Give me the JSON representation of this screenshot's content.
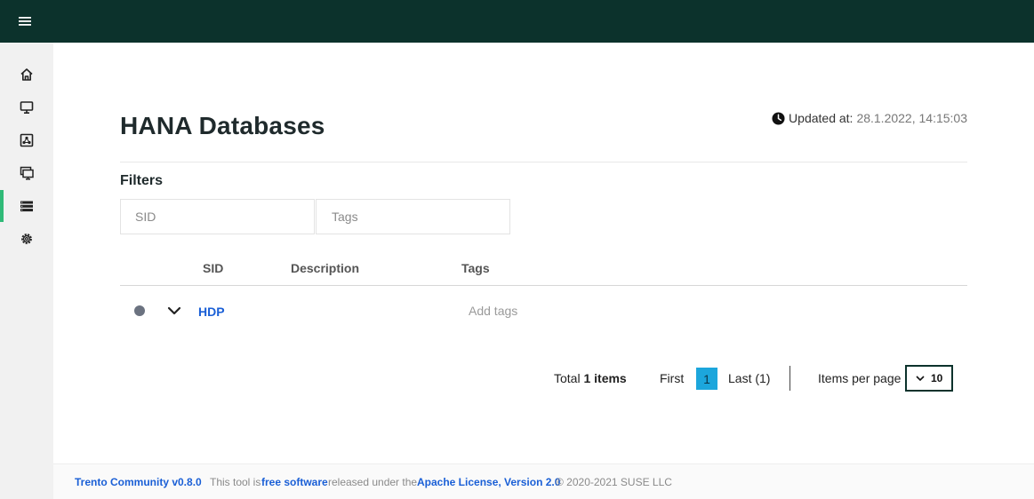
{
  "sidebar": {
    "items": [
      {
        "name": "home"
      },
      {
        "name": "hosts"
      },
      {
        "name": "clusters"
      },
      {
        "name": "sap-systems"
      },
      {
        "name": "hana-databases",
        "active": true
      },
      {
        "name": "settings"
      }
    ]
  },
  "header": {
    "title": "HANA Databases",
    "updated_label": "Updated at:",
    "updated_value": "28.1.2022, 14:15:03"
  },
  "filters": {
    "title": "Filters",
    "sid_placeholder": "SID",
    "tags_placeholder": "Tags"
  },
  "table": {
    "columns": [
      "SID",
      "Description",
      "Tags"
    ],
    "rows": [
      {
        "sid": "HDP",
        "description": "",
        "tags_placeholder": "Add tags",
        "status": "unknown"
      }
    ]
  },
  "pagination": {
    "total_prefix": "Total",
    "total_count": "1 items",
    "first": "First",
    "current_page": "1",
    "last": "Last (1)",
    "items_per_page_label": "Items per page",
    "items_per_page_value": "10"
  },
  "footer": {
    "product": "Trento Community v0.8.0",
    "text1": "This tool is",
    "link1": "free software",
    "text2": "released under the",
    "link2": "Apache License, Version 2.0",
    "copyright": "© 2020-2021 SUSE LLC"
  },
  "colors": {
    "topbar": "#0c322c",
    "accent_green": "#30ba78",
    "link_blue": "#1a5fd6",
    "page_active": "#1ca6dc"
  }
}
